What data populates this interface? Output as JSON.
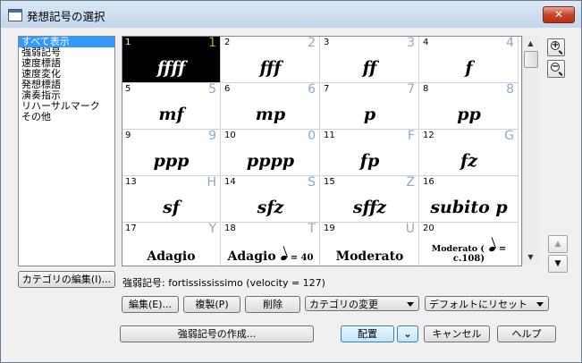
{
  "window": {
    "title": "発想記号の選択",
    "close_glyph": "✕"
  },
  "categories": {
    "items": [
      "すべて表示",
      "強弱記号",
      "速度標語",
      "速度変化",
      "発想標語",
      "演奏指示",
      "リハーサルマーク",
      "その他"
    ],
    "selected_index": 0,
    "edit_button": "カテゴリの編集(I)..."
  },
  "markings": [
    {
      "num": "1",
      "key": "1",
      "mark": "ffff"
    },
    {
      "num": "2",
      "key": "2",
      "mark": "fff"
    },
    {
      "num": "3",
      "key": "3",
      "mark": "ff"
    },
    {
      "num": "4",
      "key": "4",
      "mark": "f"
    },
    {
      "num": "5",
      "key": "5",
      "mark": "mf"
    },
    {
      "num": "6",
      "key": "6",
      "mark": "mp"
    },
    {
      "num": "7",
      "key": "7",
      "mark": "p"
    },
    {
      "num": "8",
      "key": "8",
      "mark": "pp"
    },
    {
      "num": "9",
      "key": "9",
      "mark": "ppp"
    },
    {
      "num": "10",
      "key": "0",
      "mark": "pppp"
    },
    {
      "num": "11",
      "key": "F",
      "mark": "fp"
    },
    {
      "num": "12",
      "key": "G",
      "mark": "fz"
    },
    {
      "num": "13",
      "key": "H",
      "mark": "sf"
    },
    {
      "num": "14",
      "key": "S",
      "mark": "sfz"
    },
    {
      "num": "15",
      "key": "Z",
      "mark": "sffz"
    },
    {
      "num": "16",
      "key": "",
      "mark": "subito p"
    },
    {
      "num": "17",
      "key": "Y",
      "mark": "Adagio"
    },
    {
      "num": "18",
      "key": "T",
      "mark": "Adagio",
      "suffix": "= 40"
    },
    {
      "num": "19",
      "key": "U",
      "mark": "Moderato"
    },
    {
      "num": "20",
      "key": "",
      "mark": "Moderato (",
      "suffix": "= c.108)"
    }
  ],
  "selected_marking_index": 0,
  "description": "強弱記号: fortissississimo (velocity = 127)",
  "zoom": {
    "in_glyph": "+",
    "out_glyph": "−"
  },
  "scroll": {
    "up_glyph": "▲",
    "down_glyph": "▼"
  },
  "buttons": {
    "edit": "編集(E)...",
    "duplicate": "複製(P)",
    "delete": "削除",
    "category_change": "カテゴリの変更",
    "reset_default": "デフォルトにリセット",
    "create": "強弱記号の作成...",
    "place": "配置",
    "place_dropdown_glyph": "⌄",
    "cancel": "キャンセル",
    "help": "ヘルプ"
  }
}
